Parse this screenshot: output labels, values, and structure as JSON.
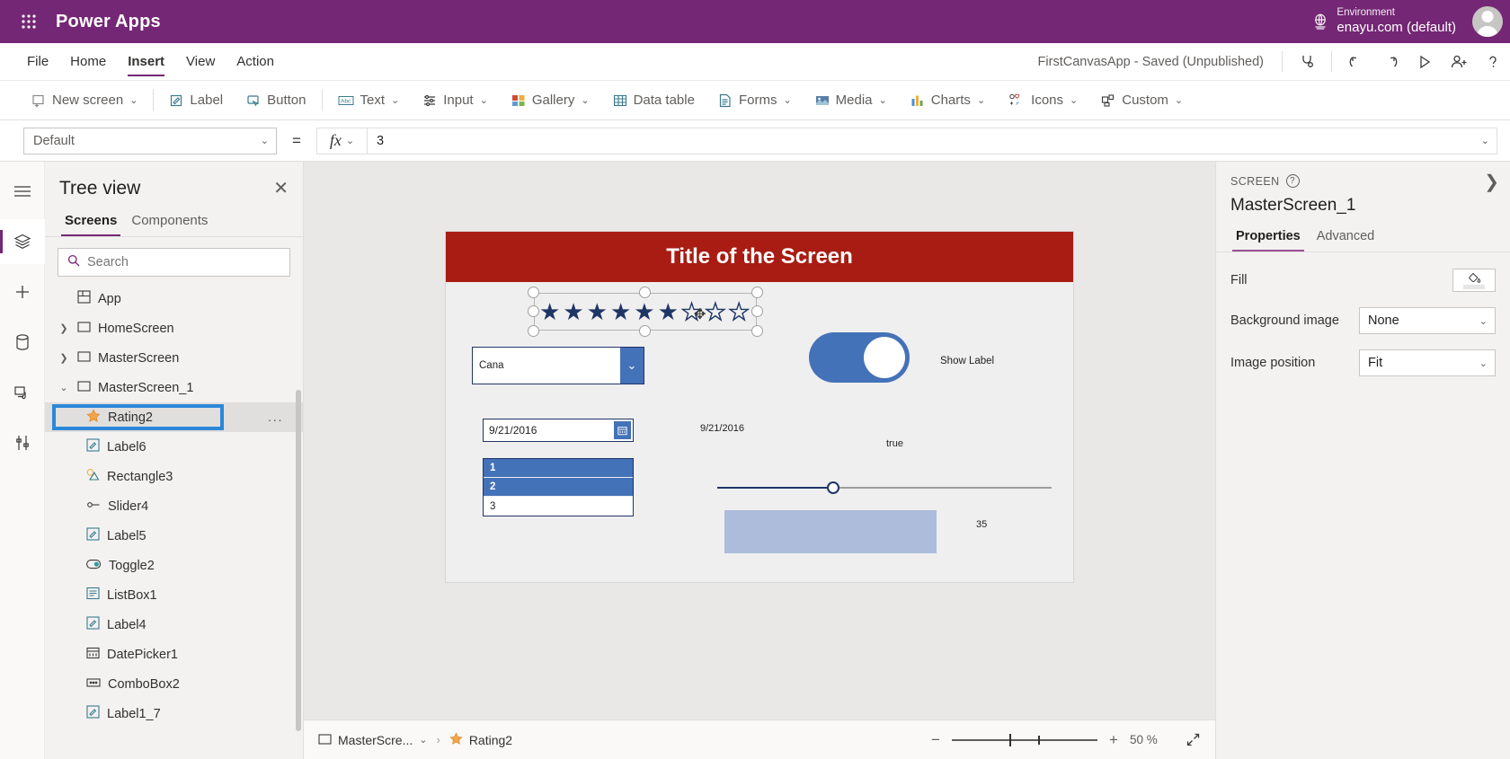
{
  "topbar": {
    "waffle_icon": "waffle-grid-icon",
    "brand": "Power Apps",
    "globe_icon": "environment-globe-icon",
    "env_label": "Environment",
    "env_value": "enayu.com (default)",
    "avatar": "user-avatar"
  },
  "menu": {
    "items": [
      {
        "label": "File",
        "active": false
      },
      {
        "label": "Home",
        "active": false
      },
      {
        "label": "Insert",
        "active": true
      },
      {
        "label": "View",
        "active": false
      },
      {
        "label": "Action",
        "active": false
      }
    ],
    "app_status": "FirstCanvasApp - Saved (Unpublished)",
    "icons": [
      {
        "name": "app-checker-icon"
      },
      {
        "name": "undo-icon"
      },
      {
        "name": "redo-icon"
      },
      {
        "name": "play-preview-icon"
      },
      {
        "name": "share-user-icon"
      },
      {
        "name": "help-icon"
      }
    ]
  },
  "ribbon": {
    "items": [
      {
        "label": "New screen",
        "icon": "new-screen-icon",
        "caret": true
      },
      {
        "label": "Label",
        "icon": "label-icon",
        "caret": false
      },
      {
        "label": "Button",
        "icon": "button-icon",
        "caret": false
      },
      {
        "label": "Text",
        "icon": "text-abc-icon",
        "caret": true
      },
      {
        "label": "Input",
        "icon": "input-sliders-icon",
        "caret": true
      },
      {
        "label": "Gallery",
        "icon": "gallery-icon",
        "caret": true
      },
      {
        "label": "Data table",
        "icon": "data-table-icon",
        "caret": false
      },
      {
        "label": "Forms",
        "icon": "forms-icon",
        "caret": true
      },
      {
        "label": "Media",
        "icon": "media-image-icon",
        "caret": true
      },
      {
        "label": "Charts",
        "icon": "charts-bar-icon",
        "caret": true
      },
      {
        "label": "Icons",
        "icon": "icons-shapes-icon",
        "caret": true
      },
      {
        "label": "Custom",
        "icon": "custom-component-icon",
        "caret": true
      }
    ]
  },
  "formula_bar": {
    "property": "Default",
    "equals": "=",
    "fx": "fx",
    "value": "3"
  },
  "rail": {
    "items": [
      {
        "name": "hamburger-menu-icon",
        "selected": false
      },
      {
        "name": "tree-view-layers-icon",
        "selected": true
      },
      {
        "name": "insert-plus-icon",
        "selected": false
      },
      {
        "name": "data-sources-icon",
        "selected": false
      },
      {
        "name": "media-library-icon",
        "selected": false
      },
      {
        "name": "advanced-tools-icon",
        "selected": false
      }
    ]
  },
  "tree_panel": {
    "title": "Tree view",
    "close_icon": "close-icon",
    "tabs": [
      {
        "label": "Screens",
        "active": true
      },
      {
        "label": "Components",
        "active": false
      }
    ],
    "search_placeholder": "Search",
    "search_value": "",
    "search_icon": "search-icon",
    "items": [
      {
        "label": "App",
        "icon": "app-icon",
        "level": 0,
        "caret": "",
        "selected": false
      },
      {
        "label": "HomeScreen",
        "icon": "screen-icon",
        "level": 0,
        "caret": "collapsed",
        "selected": false
      },
      {
        "label": "MasterScreen",
        "icon": "screen-icon",
        "level": 0,
        "caret": "collapsed",
        "selected": false
      },
      {
        "label": "MasterScreen_1",
        "icon": "screen-icon",
        "level": 0,
        "caret": "expanded",
        "selected": false
      },
      {
        "label": "Rating2",
        "icon": "rating-star-icon",
        "level": 1,
        "caret": "",
        "selected": true
      },
      {
        "label": "Label6",
        "icon": "label-icon",
        "level": 1,
        "caret": "",
        "selected": false
      },
      {
        "label": "Rectangle3",
        "icon": "rectangle-icon",
        "level": 1,
        "caret": "",
        "selected": false
      },
      {
        "label": "Slider4",
        "icon": "slider-icon",
        "level": 1,
        "caret": "",
        "selected": false
      },
      {
        "label": "Label5",
        "icon": "label-icon",
        "level": 1,
        "caret": "",
        "selected": false
      },
      {
        "label": "Toggle2",
        "icon": "toggle-icon",
        "level": 1,
        "caret": "",
        "selected": false
      },
      {
        "label": "ListBox1",
        "icon": "listbox-icon",
        "level": 1,
        "caret": "",
        "selected": false
      },
      {
        "label": "Label4",
        "icon": "label-icon",
        "level": 1,
        "caret": "",
        "selected": false
      },
      {
        "label": "DatePicker1",
        "icon": "datepicker-icon",
        "level": 1,
        "caret": "",
        "selected": false
      },
      {
        "label": "ComboBox2",
        "icon": "combobox-icon",
        "level": 1,
        "caret": "",
        "selected": false
      },
      {
        "label": "Label1_7",
        "icon": "label-icon",
        "level": 1,
        "caret": "",
        "selected": false
      }
    ],
    "context_menu_dots": "..."
  },
  "canvas": {
    "screen_title": "Title of the Screen",
    "title_bg": "#a81c13",
    "screen_bg": "#efefef",
    "rating": {
      "name": "Rating2",
      "filled_count": 6,
      "empty_count": 3,
      "filled_glyph": "★",
      "empty_glyph": "★",
      "color": "#1f3566"
    },
    "combobox": {
      "value": "Cana",
      "chevron": "⌄"
    },
    "toggle": {
      "state": "on",
      "color": "#4472b8"
    },
    "show_label": "Show Label",
    "datepicker": {
      "value": "9/21/2016",
      "icon": "calendar-icon"
    },
    "date_label": "9/21/2016",
    "bool_label": "true",
    "listbox": {
      "options": [
        {
          "label": "1",
          "selected": true
        },
        {
          "label": "2",
          "selected": true
        },
        {
          "label": "3",
          "selected": false
        }
      ]
    },
    "slider": {
      "value": 35,
      "min": 0,
      "max": 100
    },
    "rectangle": {
      "fill": "#adbcda"
    },
    "slider_value_label": "35"
  },
  "status_bar": {
    "breadcrumb": [
      {
        "label": "MasterScre...",
        "icon": "screen-icon",
        "caret": true
      },
      {
        "label": "Rating2",
        "icon": "rating-star-icon",
        "caret": false
      }
    ],
    "separator": "›",
    "zoom_minus": "−",
    "zoom_plus": "+",
    "zoom_value": "50",
    "zoom_unit": "%",
    "expand_icon": "fit-screen-icon"
  },
  "properties_panel": {
    "kicker": "SCREEN",
    "help_icon": "help-circle-icon",
    "name": "MasterScreen_1",
    "collapse_icon": "chevron-right-icon",
    "tabs": [
      {
        "label": "Properties",
        "active": true
      },
      {
        "label": "Advanced",
        "active": false
      }
    ],
    "rows": [
      {
        "label": "Fill",
        "type": "color",
        "value": "",
        "icon": "paint-bucket-icon",
        "swatch": "#e6e6e6"
      },
      {
        "label": "Background image",
        "type": "select",
        "value": "None"
      },
      {
        "label": "Image position",
        "type": "select",
        "value": "Fit"
      }
    ]
  }
}
